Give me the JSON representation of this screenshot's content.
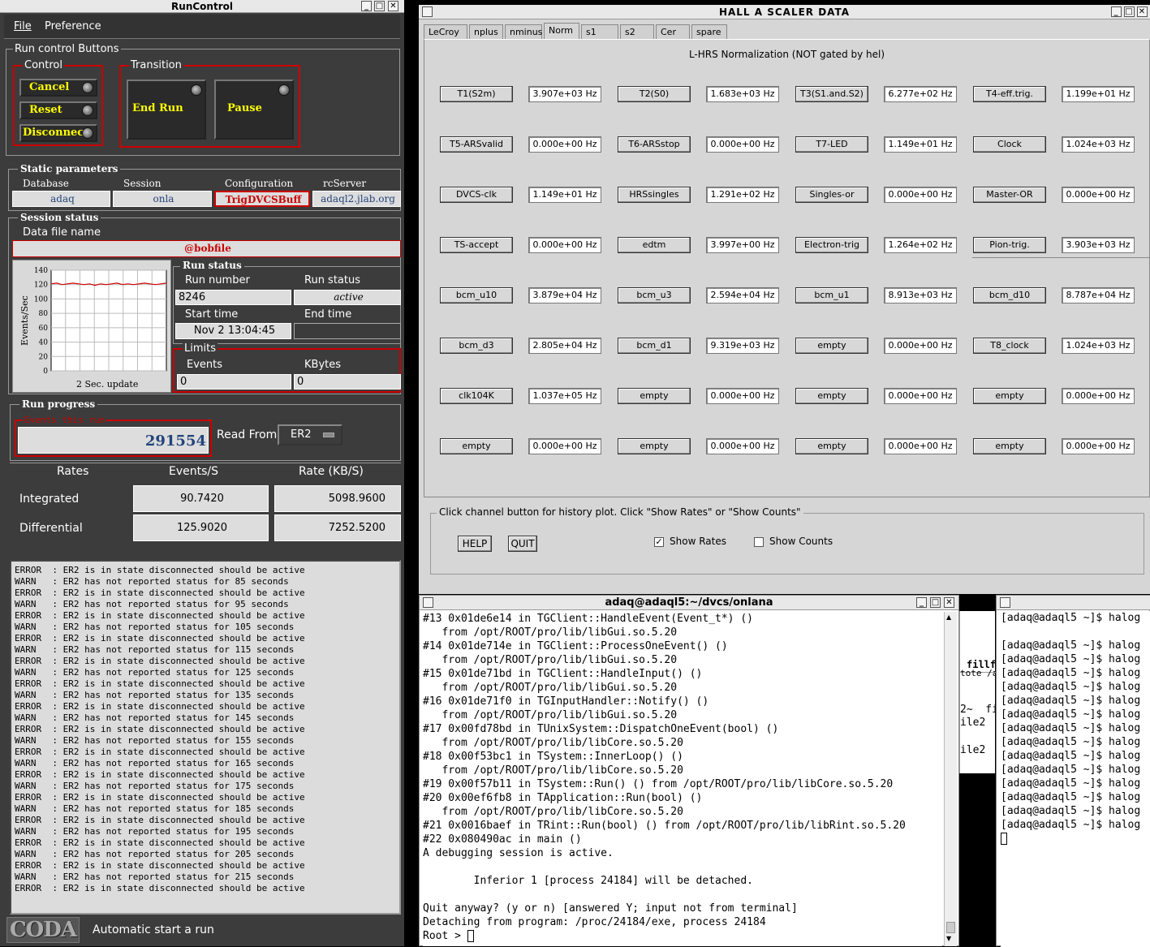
{
  "runcontrol": {
    "title": "RunControl",
    "menu": [
      "File",
      "Preference"
    ],
    "run_control_buttons": "Run control Buttons",
    "control_label": "Control",
    "control_buttons": [
      "Cancel",
      "Reset",
      "Disconnect"
    ],
    "transition_label": "Transition",
    "transition_buttons": [
      "End Run",
      "Pause"
    ],
    "static_params_label": "Static parameters",
    "static_params": [
      {
        "header": "Database",
        "value": "adaq"
      },
      {
        "header": "Session",
        "value": "onla"
      },
      {
        "header": "Configuration",
        "value": "TrigDVCSBuff"
      },
      {
        "header": "rcServer",
        "value": "adaql2.jlab.org"
      }
    ],
    "session_status_label": "Session status",
    "data_file_label": "Data file name",
    "data_file": "@bobfile",
    "plot_ylabel": "Events/Sec",
    "plot_yticks": [
      "140",
      "120",
      "100",
      "80",
      "60",
      "40",
      "20",
      "0"
    ],
    "plot_footer": "2 Sec. update",
    "run_status_group": "Run status",
    "run_number_label": "Run number",
    "run_number": "8246",
    "run_status_label": "Run status",
    "run_status": "active",
    "start_time_label": "Start time",
    "start_time": "Nov 2 13:04:45",
    "end_time_label": "End time",
    "end_time": "",
    "limits_label": "Limits",
    "events_label": "Events",
    "events_limit": "0",
    "kbytes_label": "KBytes",
    "kbytes_limit": "0",
    "run_progress_label": "Run progress",
    "events_this_run_label": "Events this run",
    "events_this_run": "291554",
    "read_from_label": "Read From:",
    "read_from": "ER2",
    "rates_headers": [
      "Rates",
      "Events/S",
      "Rate (KB/S)"
    ],
    "rates_rows": [
      {
        "label": "Integrated",
        "events": "90.7420",
        "kb": "5098.9600"
      },
      {
        "label": "Differential",
        "events": "125.9020",
        "kb": "7252.5200"
      }
    ],
    "log": [
      "ERROR  : ER2 is in state disconnected should be active",
      "WARN   : ER2 has not reported status for 85 seconds",
      "ERROR  : ER2 is in state disconnected should be active",
      "WARN   : ER2 has not reported status for 95 seconds",
      "ERROR  : ER2 is in state disconnected should be active",
      "WARN   : ER2 has not reported status for 105 seconds",
      "ERROR  : ER2 is in state disconnected should be active",
      "WARN   : ER2 has not reported status for 115 seconds",
      "ERROR  : ER2 is in state disconnected should be active",
      "WARN   : ER2 has not reported status for 125 seconds",
      "ERROR  : ER2 is in state disconnected should be active",
      "WARN   : ER2 has not reported status for 135 seconds",
      "ERROR  : ER2 is in state disconnected should be active",
      "WARN   : ER2 has not reported status for 145 seconds",
      "ERROR  : ER2 is in state disconnected should be active",
      "WARN   : ER2 has not reported status for 155 seconds",
      "ERROR  : ER2 is in state disconnected should be active",
      "WARN   : ER2 has not reported status for 165 seconds",
      "ERROR  : ER2 is in state disconnected should be active",
      "WARN   : ER2 has not reported status for 175 seconds",
      "ERROR  : ER2 is in state disconnected should be active",
      "WARN   : ER2 has not reported status for 185 seconds",
      "ERROR  : ER2 is in state disconnected should be active",
      "WARN   : ER2 has not reported status for 195 seconds",
      "ERROR  : ER2 is in state disconnected should be active",
      "WARN   : ER2 has not reported status for 205 seconds",
      "ERROR  : ER2 is in state disconnected should be active",
      "WARN   : ER2 has not reported status for 215 seconds",
      "ERROR  : ER2 is in state disconnected should be active"
    ],
    "logo": "CODA",
    "status_text": "Automatic start a run"
  },
  "scaler": {
    "title": "HALL  A  SCALER  DATA",
    "tabs": [
      "LeCroy",
      "nplus",
      "nminus",
      "Norm",
      "s1",
      "s2",
      "Cer",
      "spare"
    ],
    "active_tab": "Norm",
    "heading": "L-HRS Normalization (NOT gated by hel)",
    "rows": [
      [
        [
          "T1(S2m)",
          "3.907e+03 Hz"
        ],
        [
          "T2(S0)",
          "1.683e+03 Hz"
        ],
        [
          "T3(S1.and.S2)",
          "6.277e+02 Hz"
        ],
        [
          "T4-eff.trig.",
          "1.199e+01 Hz"
        ]
      ],
      [
        [
          "T5-ARSvalid",
          "0.000e+00 Hz"
        ],
        [
          "T6-ARSstop",
          "0.000e+00 Hz"
        ],
        [
          "T7-LED",
          "1.149e+01 Hz"
        ],
        [
          "Clock",
          "1.024e+03 Hz"
        ]
      ],
      [
        [
          "DVCS-clk",
          "1.149e+01 Hz"
        ],
        [
          "HRSsingles",
          "1.291e+02 Hz"
        ],
        [
          "Singles-or",
          "0.000e+00 Hz"
        ],
        [
          "Master-OR",
          "0.000e+00 Hz"
        ]
      ],
      [
        [
          "TS-accept",
          "0.000e+00 Hz"
        ],
        [
          "edtm",
          "3.997e+00 Hz"
        ],
        [
          "Electron-trig",
          "1.264e+02 Hz"
        ],
        [
          "Pion-trig.",
          "3.903e+03 Hz"
        ]
      ],
      [
        [
          "bcm_u10",
          "3.879e+04 Hz"
        ],
        [
          "bcm_u3",
          "2.594e+04 Hz"
        ],
        [
          "bcm_u1",
          "8.913e+03 Hz"
        ],
        [
          "bcm_d10",
          "8.787e+04 Hz"
        ]
      ],
      [
        [
          "bcm_d3",
          "2.805e+04 Hz"
        ],
        [
          "bcm_d1",
          "9.319e+03 Hz"
        ],
        [
          "empty",
          "0.000e+00 Hz"
        ],
        [
          "T8_clock",
          "1.024e+03 Hz"
        ]
      ],
      [
        [
          "clk104K",
          "1.037e+05 Hz"
        ],
        [
          "empty",
          "0.000e+00 Hz"
        ],
        [
          "empty",
          "0.000e+00 Hz"
        ],
        [
          "empty",
          "0.000e+00 Hz"
        ]
      ],
      [
        [
          "empty",
          "0.000e+00 Hz"
        ],
        [
          "empty",
          "0.000e+00 Hz"
        ],
        [
          "empty",
          "0.000e+00 Hz"
        ],
        [
          "empty",
          "0.000e+00 Hz"
        ]
      ]
    ],
    "bottom_label": "Click channel button for history plot.  Click \"Show Rates\" or \"Show Counts\"",
    "help": "HELP",
    "quit": "QUIT",
    "show_rates": "Show Rates",
    "show_counts": "Show Counts"
  },
  "term1": {
    "title": "adaq@adaql5:~/dvcs/onlana",
    "lines": [
      "#13 0x01de6e14 in TGClient::HandleEvent(Event_t*) ()",
      "   from /opt/ROOT/pro/lib/libGui.so.5.20",
      "#14 0x01de714e in TGClient::ProcessOneEvent() ()",
      "   from /opt/ROOT/pro/lib/libGui.so.5.20",
      "#15 0x01de71bd in TGClient::HandleInput() ()",
      "   from /opt/ROOT/pro/lib/libGui.so.5.20",
      "#16 0x01de71f0 in TGInputHandler::Notify() ()",
      "   from /opt/ROOT/pro/lib/libGui.so.5.20",
      "#17 0x00fd78bd in TUnixSystem::DispatchOneEvent(bool) ()",
      "   from /opt/ROOT/pro/lib/libCore.so.5.20",
      "#18 0x00f53bc1 in TSystem::InnerLoop() ()",
      "   from /opt/ROOT/pro/lib/libCore.so.5.20",
      "#19 0x00f57b11 in TSystem::Run() () from /opt/ROOT/pro/lib/libCore.so.5.20",
      "#20 0x00ef6fb8 in TApplication::Run(bool) ()",
      "   from /opt/ROOT/pro/lib/libCore.so.5.20",
      "#21 0x0016baef in TRint::Run(bool) () from /opt/ROOT/pro/lib/libRint.so.5.20",
      "#22 0x080490ac in main ()",
      "A debugging session is active.",
      "",
      "        Inferior 1 [process 24184] will be detached.",
      "",
      "Quit anyway? (y or n) [answered Y; input not from terminal]",
      "Detaching from program: /proc/24184/exe, process 24184",
      "Root > "
    ]
  },
  "term2": {
    "lines": [
      "[adaq@adaql5 ~]$ halog",
      "",
      "[adaq@adaql5 ~]$ halog",
      "[adaq@adaql5 ~]$ halog",
      "[adaq@adaql5 ~]$ halog",
      "[adaq@adaql5 ~]$ halog",
      "[adaq@adaql5 ~]$ halog",
      "[adaq@adaql5 ~]$ halog",
      "[adaq@adaql5 ~]$ halog",
      "[adaq@adaql5 ~]$ halog",
      "[adaq@adaql5 ~]$ halog",
      "[adaq@adaql5 ~]$ halog",
      "[adaq@adaql5 ~]$ halog",
      "[adaq@adaql5 ~]$ halog",
      "[adaq@adaql5 ~]$ halog",
      "[adaq@adaql5 ~]$ halog"
    ]
  },
  "bg_window": {
    "lines": [
      "fillf",
      "tote /a",
      "2~  fi",
      "ile2",
      "ile2"
    ]
  },
  "colors": {
    "accent_red": "#cc0000",
    "button_text": "#ffff00",
    "panel_dark": "#3c3c3c",
    "scaler_bg": "#d6d6d6"
  }
}
